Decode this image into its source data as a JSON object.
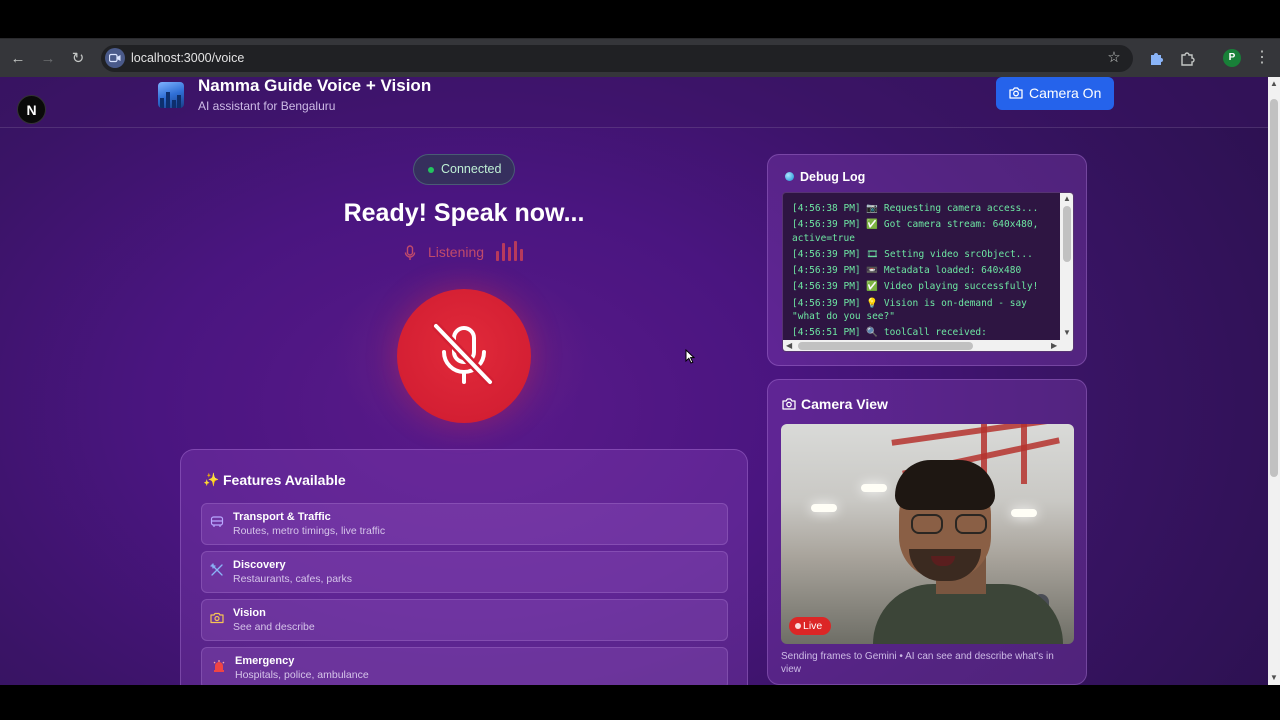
{
  "browser": {
    "url": "localhost:3000/voice",
    "profile_initial": "P"
  },
  "header": {
    "framework_badge": "N",
    "title": "Namma Guide Voice + Vision",
    "subtitle": "AI assistant for Bengaluru",
    "camera_button_label": "Camera On"
  },
  "voice": {
    "status": "Connected",
    "headline": "Ready! Speak now...",
    "listening_label": "Listening",
    "mic_state": "muted"
  },
  "features": {
    "title": "Features Available",
    "items": [
      {
        "name": "Transport & Traffic",
        "desc": "Routes, metro timings, live traffic",
        "icon": "bus-icon"
      },
      {
        "name": "Discovery",
        "desc": "Restaurants, cafes, parks",
        "icon": "utensils-icon"
      },
      {
        "name": "Vision",
        "desc": "See and describe",
        "icon": "camera-icon"
      },
      {
        "name": "Emergency",
        "desc": "Hospitals, police, ambulance",
        "icon": "siren-icon"
      }
    ]
  },
  "debug": {
    "title": "Debug Log",
    "lines": [
      "[4:56:38 PM] 📷 Requesting camera access...",
      "[4:56:39 PM] ✅ Got camera stream: 640x480, active=true",
      "[4:56:39 PM] 🎞 Setting video srcObject...",
      "[4:56:39 PM] 📼 Metadata loaded: 640x480",
      "[4:56:39 PM] ✅ Video playing successfully!",
      "[4:56:39 PM] 💡 Vision is on-demand - say \"what do you see?\"",
      "[4:56:51 PM] 🔍 toolCall received:"
    ]
  },
  "camera": {
    "title": "Camera View",
    "live_label": "Live",
    "caption": "Sending frames to Gemini • AI can see and describe what's in view"
  },
  "colors": {
    "accent_blue": "#2563eb",
    "mic_red": "#d41f33",
    "connected_green": "#22c55e",
    "log_green": "#6ee7a3",
    "live_red": "#dc2626"
  }
}
